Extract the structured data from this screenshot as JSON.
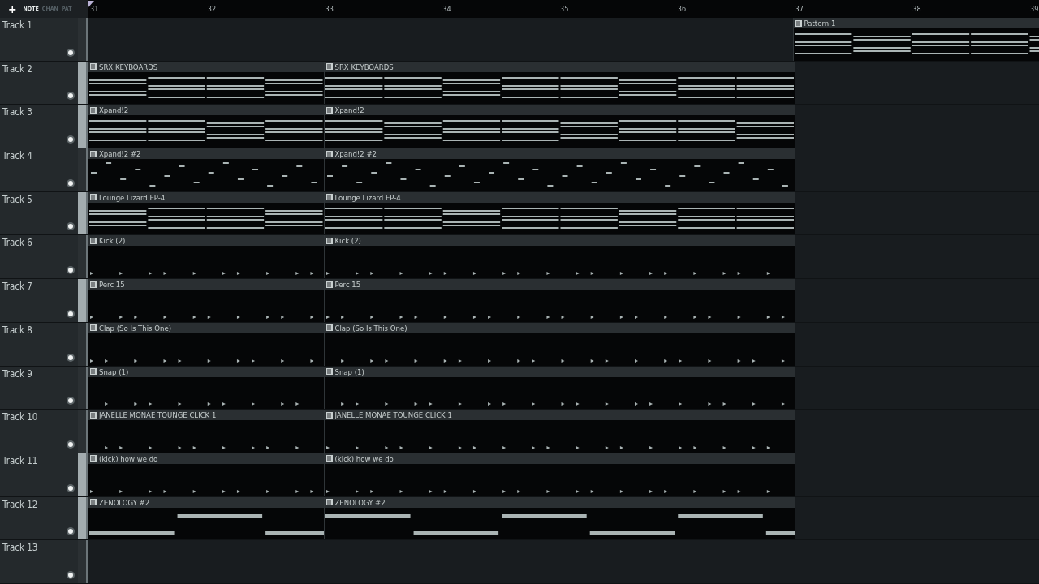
{
  "toolbar": {
    "add_button": "+",
    "tabs": [
      {
        "label": "NOTE",
        "selected": true
      },
      {
        "label": "CHAN",
        "selected": false
      },
      {
        "label": "PAT",
        "selected": false
      }
    ]
  },
  "ruler": {
    "bars": [
      "31",
      "32",
      "33",
      "34",
      "35",
      "36",
      "37",
      "38",
      "39"
    ]
  },
  "tracks": [
    {
      "name": "Track 1",
      "selected": false,
      "clips": [
        {
          "name": "Pattern 1",
          "kind": "pattern"
        }
      ]
    },
    {
      "name": "Track 2",
      "selected": true,
      "clips": [
        {
          "name": "SRX KEYBOARDS",
          "kind": "chords"
        },
        {
          "name": "SRX KEYBOARDS",
          "kind": "chords"
        }
      ]
    },
    {
      "name": "Track 3",
      "selected": true,
      "clips": [
        {
          "name": "Xpand!2",
          "kind": "chords"
        },
        {
          "name": "Xpand!2",
          "kind": "chords"
        }
      ]
    },
    {
      "name": "Track 4",
      "selected": false,
      "clips": [
        {
          "name": "Xpand!2 #2",
          "kind": "melody"
        },
        {
          "name": "Xpand!2 #2",
          "kind": "melody"
        }
      ]
    },
    {
      "name": "Track 5",
      "selected": true,
      "clips": [
        {
          "name": "Lounge Lizard EP-4",
          "kind": "chords"
        },
        {
          "name": "Lounge Lizard EP-4",
          "kind": "chords"
        }
      ]
    },
    {
      "name": "Track 6",
      "selected": false,
      "clips": [
        {
          "name": "Kick (2)",
          "kind": "hits"
        },
        {
          "name": "Kick (2)",
          "kind": "hits"
        }
      ]
    },
    {
      "name": "Track 7",
      "selected": true,
      "clips": [
        {
          "name": "Perc 15",
          "kind": "hits"
        },
        {
          "name": "Perc 15",
          "kind": "hits"
        }
      ]
    },
    {
      "name": "Track 8",
      "selected": false,
      "clips": [
        {
          "name": "Clap (So Is This One)",
          "kind": "hits"
        },
        {
          "name": "Clap (So Is This One)",
          "kind": "hits"
        }
      ]
    },
    {
      "name": "Track 9",
      "selected": false,
      "clips": [
        {
          "name": "Snap (1)",
          "kind": "hits"
        },
        {
          "name": "Snap (1)",
          "kind": "hits"
        }
      ]
    },
    {
      "name": "Track 10",
      "selected": false,
      "clips": [
        {
          "name": "JANELLE MONAE TOUNGE CLICK 1",
          "kind": "hits"
        },
        {
          "name": "JANELLE MONAE TOUNGE CLICK 1",
          "kind": "hits"
        }
      ]
    },
    {
      "name": "Track 11",
      "selected": true,
      "clips": [
        {
          "name": "(kick) how we do",
          "kind": "hits"
        },
        {
          "name": "(kick) how we do",
          "kind": "hits"
        }
      ]
    },
    {
      "name": "Track 12",
      "selected": true,
      "clips": [
        {
          "name": "ZENOLOGY #2",
          "kind": "bass"
        },
        {
          "name": "ZENOLOGY #2",
          "kind": "bass"
        }
      ]
    },
    {
      "name": "Track 13",
      "selected": false
    }
  ]
}
